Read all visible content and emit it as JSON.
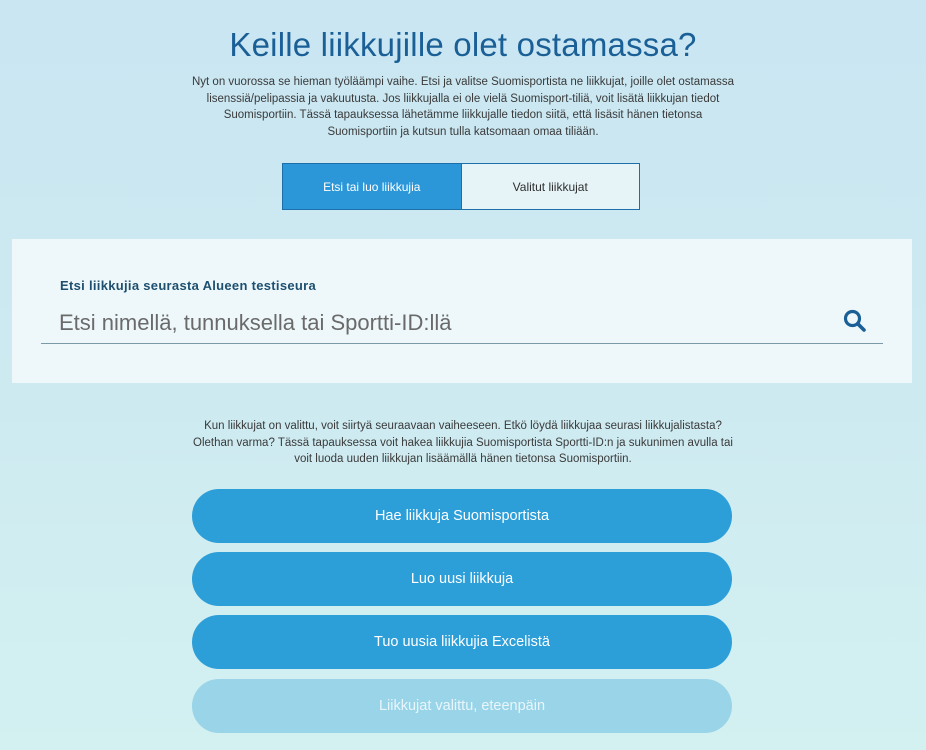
{
  "header": {
    "title": "Keille liikkujille olet ostamassa?",
    "intro": "Nyt on vuorossa se hieman työläämpi vaihe. Etsi ja valitse Suomisportista ne liikkujat, joille olet ostamassa lisenssiä/pelipassia ja vakuutusta. Jos liikkujalla ei ole vielä Suomisport-tiliä, voit lisätä liikkujan tiedot Suomisportiin. Tässä tapauksessa lähetämme liikkujalle tiedon siitä, että lisäsit hänen tietonsa Suomisportiin ja kutsun tulla katsomaan omaa tiliään."
  },
  "tabs": {
    "search_create": "Etsi tai luo liikkujia",
    "selected": "Valitut liikkujat"
  },
  "search": {
    "label": "Etsi liikkujia seurasta Alueen testiseura",
    "placeholder": "Etsi nimellä, tunnuksella tai Sportti-ID:llä",
    "value": ""
  },
  "help_text": "Kun liikkujat on valittu, voit siirtyä seuraavaan vaiheeseen. Etkö löydä liikkujaa seurasi liikkujalistasta? Olethan varma? Tässä tapauksessa voit hakea liikkujia Suomisportista Sportti-ID:n ja sukunimen avulla tai voit luoda uuden liikkujan lisäämällä hänen tietonsa Suomisportiin.",
  "actions": {
    "fetch_from_suomisport": "Hae liikkuja Suomisportista",
    "create_new": "Luo uusi liikkuja",
    "import_excel": "Tuo uusia liikkujia Excelistä",
    "continue_disabled": "Liikkujat valittu, eteenpäin"
  },
  "colors": {
    "accent": "#2c9ed8",
    "title": "#1a5f96",
    "disabled": "#99d4e8"
  },
  "icons": {
    "search": "search-icon"
  }
}
